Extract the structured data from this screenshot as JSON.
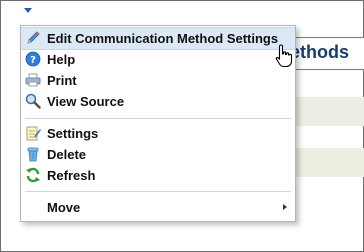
{
  "page": {
    "title_fragment": "ethods"
  },
  "menu": {
    "items": [
      {
        "label": "Edit Communication Method Settings",
        "icon": "pencil-icon"
      },
      {
        "label": "Help",
        "icon": "help-icon"
      },
      {
        "label": "Print",
        "icon": "printer-icon"
      },
      {
        "label": "View Source",
        "icon": "magnifier-icon"
      },
      {
        "label": "Settings",
        "icon": "notepad-icon"
      },
      {
        "label": "Delete",
        "icon": "trash-icon"
      },
      {
        "label": "Refresh",
        "icon": "refresh-icon"
      },
      {
        "label": "Move",
        "icon": "none"
      }
    ]
  },
  "colors": {
    "accent_red": "#d9534f",
    "title_blue": "#1a3c6e",
    "highlight": "#dde8f7",
    "band": "#efeee2"
  }
}
